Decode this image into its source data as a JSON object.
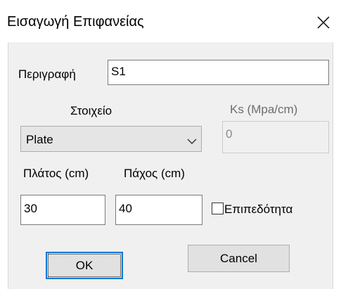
{
  "window": {
    "title": "Εισαγωγή Επιφανείας",
    "close_icon": "close-icon"
  },
  "form": {
    "description_label": "Περιγραφή",
    "description_value": "S1",
    "element_label": "Στοιχείο",
    "element_value": "Plate",
    "ks_label": "Ks (Mpa/cm)",
    "ks_value": "0",
    "width_label": "Πλάτος (cm)",
    "width_value": "30",
    "thickness_label": "Πάχος (cm)",
    "thickness_value": "40",
    "planarity_label": "Επιπεδότητα",
    "planarity_checked": false
  },
  "buttons": {
    "ok_label": "OK",
    "cancel_label": "Cancel"
  }
}
